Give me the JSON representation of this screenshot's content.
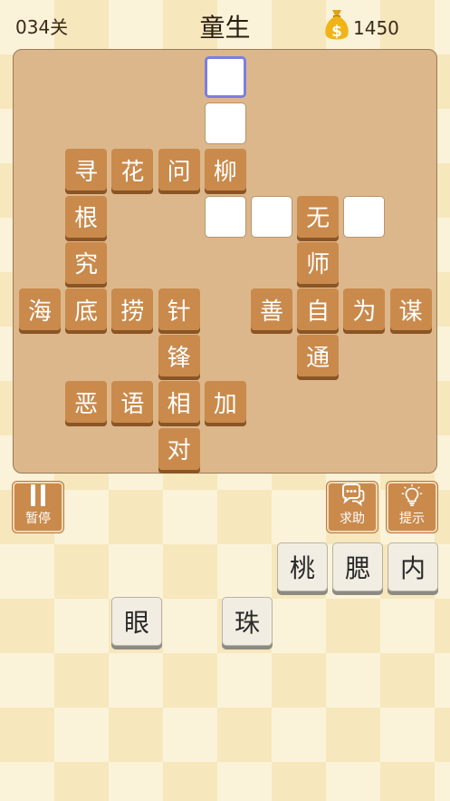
{
  "header": {
    "level_label": "034关",
    "title": "童生",
    "coins": "1450"
  },
  "board": {
    "cells": [
      {
        "row": 0,
        "col": 4,
        "char": "",
        "state": "selected"
      },
      {
        "row": 1,
        "col": 4,
        "char": "",
        "state": "empty"
      },
      {
        "row": 2,
        "col": 1,
        "char": "寻",
        "state": "filled"
      },
      {
        "row": 2,
        "col": 2,
        "char": "花",
        "state": "filled"
      },
      {
        "row": 2,
        "col": 3,
        "char": "问",
        "state": "filled"
      },
      {
        "row": 2,
        "col": 4,
        "char": "柳",
        "state": "filled"
      },
      {
        "row": 3,
        "col": 1,
        "char": "根",
        "state": "filled"
      },
      {
        "row": 3,
        "col": 4,
        "char": "",
        "state": "empty"
      },
      {
        "row": 3,
        "col": 5,
        "char": "",
        "state": "empty"
      },
      {
        "row": 3,
        "col": 6,
        "char": "无",
        "state": "filled"
      },
      {
        "row": 3,
        "col": 7,
        "char": "",
        "state": "empty"
      },
      {
        "row": 4,
        "col": 1,
        "char": "究",
        "state": "filled"
      },
      {
        "row": 4,
        "col": 6,
        "char": "师",
        "state": "filled"
      },
      {
        "row": 5,
        "col": 0,
        "char": "海",
        "state": "filled"
      },
      {
        "row": 5,
        "col": 1,
        "char": "底",
        "state": "filled"
      },
      {
        "row": 5,
        "col": 2,
        "char": "捞",
        "state": "filled"
      },
      {
        "row": 5,
        "col": 3,
        "char": "针",
        "state": "filled"
      },
      {
        "row": 5,
        "col": 5,
        "char": "善",
        "state": "filled"
      },
      {
        "row": 5,
        "col": 6,
        "char": "自",
        "state": "filled"
      },
      {
        "row": 5,
        "col": 7,
        "char": "为",
        "state": "filled"
      },
      {
        "row": 5,
        "col": 8,
        "char": "谋",
        "state": "filled"
      },
      {
        "row": 6,
        "col": 3,
        "char": "锋",
        "state": "filled"
      },
      {
        "row": 6,
        "col": 6,
        "char": "通",
        "state": "filled"
      },
      {
        "row": 7,
        "col": 1,
        "char": "恶",
        "state": "filled"
      },
      {
        "row": 7,
        "col": 2,
        "char": "语",
        "state": "filled"
      },
      {
        "row": 7,
        "col": 3,
        "char": "相",
        "state": "filled"
      },
      {
        "row": 7,
        "col": 4,
        "char": "加",
        "state": "filled"
      },
      {
        "row": 8,
        "col": 3,
        "char": "对",
        "state": "filled"
      }
    ]
  },
  "controls": {
    "pause_label": "暂停",
    "help_label": "求助",
    "hint_label": "提示"
  },
  "candidates": [
    {
      "char": "桃",
      "row": 0,
      "col": 5
    },
    {
      "char": "腮",
      "row": 0,
      "col": 6
    },
    {
      "char": "内",
      "row": 0,
      "col": 7
    },
    {
      "char": "眼",
      "row": 1,
      "col": 2
    },
    {
      "char": "珠",
      "row": 1,
      "col": 4
    }
  ],
  "colors": {
    "tile_filled": "#c98a4c",
    "board": "#dcb78b",
    "selected_border": "#7b7ee2"
  }
}
